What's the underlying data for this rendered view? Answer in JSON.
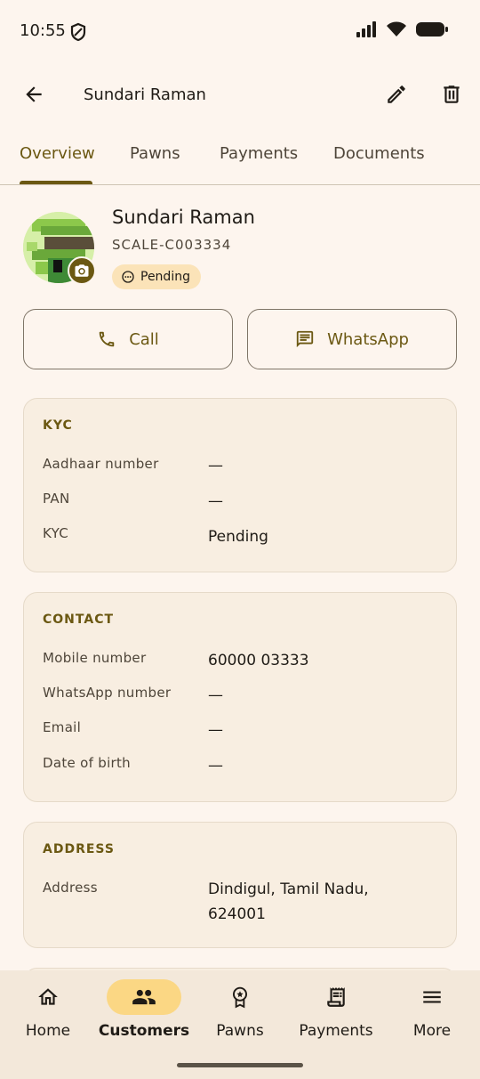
{
  "status_bar": {
    "time": "10:55"
  },
  "app_bar": {
    "title": "Sundari Raman"
  },
  "tabs": [
    {
      "label": "Overview",
      "active": true
    },
    {
      "label": "Pawns",
      "active": false
    },
    {
      "label": "Payments",
      "active": false
    },
    {
      "label": "Documents",
      "active": false
    }
  ],
  "profile": {
    "name": "Sundari Raman",
    "id": "SCALE-C003334",
    "status": "Pending"
  },
  "actions": {
    "call": "Call",
    "whatsapp": "WhatsApp"
  },
  "kyc": {
    "title": "KYC",
    "rows": [
      {
        "label": "Aadhaar number",
        "value": "—"
      },
      {
        "label": "PAN",
        "value": "—"
      },
      {
        "label": "KYC",
        "value": "Pending"
      }
    ]
  },
  "contact": {
    "title": "CONTACT",
    "rows": [
      {
        "label": "Mobile number",
        "value": "60000 03333"
      },
      {
        "label": "WhatsApp number",
        "value": "—"
      },
      {
        "label": "Email",
        "value": "—"
      },
      {
        "label": "Date of birth",
        "value": "—"
      }
    ]
  },
  "address": {
    "title": "ADDRESS",
    "rows": [
      {
        "label": "Address",
        "value": "Dindigul, Tamil Nadu, 624001"
      }
    ]
  },
  "bottom_nav": [
    {
      "label": "Home",
      "icon": "home-icon",
      "active": false
    },
    {
      "label": "Customers",
      "icon": "people-icon",
      "active": true
    },
    {
      "label": "Pawns",
      "icon": "badge-icon",
      "active": false
    },
    {
      "label": "Payments",
      "icon": "receipt-icon",
      "active": false
    },
    {
      "label": "More",
      "icon": "menu-icon",
      "active": false
    }
  ],
  "colors": {
    "accent": "#6b5812",
    "background": "#fdf5ee",
    "chip": "#fbe3b8",
    "nav_active": "#fbd784"
  }
}
